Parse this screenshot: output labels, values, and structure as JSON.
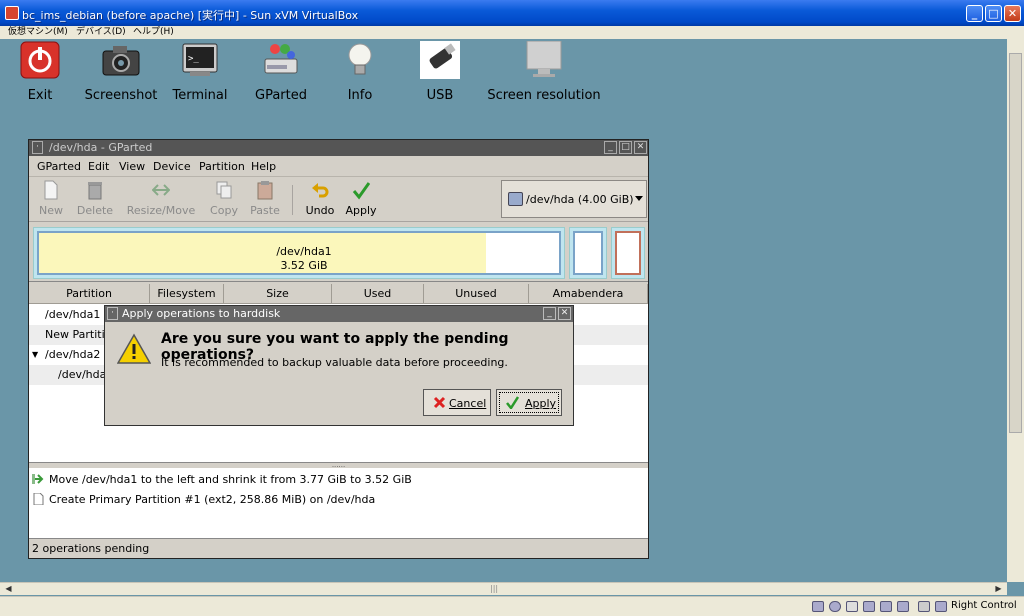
{
  "host": {
    "title": "bc_ims_debian (before apache) [実行中] - Sun xVM VirtualBox",
    "menu": [
      "仮想マシン(M)",
      "デバイス(D)",
      "ヘルプ(H)"
    ],
    "host_key": "Right Control",
    "scroll_glyph": "|||"
  },
  "desktop": {
    "icons": [
      {
        "label": "Exit",
        "icon": "power-icon"
      },
      {
        "label": "Screenshot",
        "icon": "camera-icon"
      },
      {
        "label": "Terminal",
        "icon": "terminal-icon"
      },
      {
        "label": "GParted",
        "icon": "gparted-icon"
      },
      {
        "label": "Info",
        "icon": "lightbulb-icon"
      },
      {
        "label": "USB",
        "icon": "usb-icon"
      },
      {
        "label": "Screen resolution",
        "icon": "monitor-icon"
      }
    ]
  },
  "gparted": {
    "title": "/dev/hda - GParted",
    "menu": [
      "GParted",
      "Edit",
      "View",
      "Device",
      "Partition",
      "Help"
    ],
    "toolbar": {
      "new": "New",
      "delete": "Delete",
      "resize": "Resize/Move",
      "copy": "Copy",
      "paste": "Paste",
      "undo": "Undo",
      "apply": "Apply"
    },
    "device": "/dev/hda  (4.00 GiB)",
    "map": {
      "name": "/dev/hda1",
      "size": "3.52 GiB"
    },
    "columns": [
      "Partition",
      "Filesystem",
      "Size",
      "Used",
      "Unused",
      "Amabendera"
    ],
    "rows": [
      {
        "partition": "/dev/hda1"
      },
      {
        "partition": "New Partitio"
      },
      {
        "partition": "/dev/hda2"
      },
      {
        "partition": "/dev/hda"
      }
    ],
    "operations": [
      "Move /dev/hda1 to the left and shrink it from 3.77 GiB to 3.52 GiB",
      "Create Primary Partition #1 (ext2, 258.86 MiB) on /dev/hda"
    ],
    "status": "2 operations pending",
    "splitter_glyph": "......"
  },
  "dialog": {
    "title": "Apply operations to harddisk",
    "question": "Are you sure you want to apply the pending operations?",
    "subtext": "It is recommended to backup valuable data before proceeding.",
    "cancel": "Cancel",
    "apply": "Apply"
  }
}
